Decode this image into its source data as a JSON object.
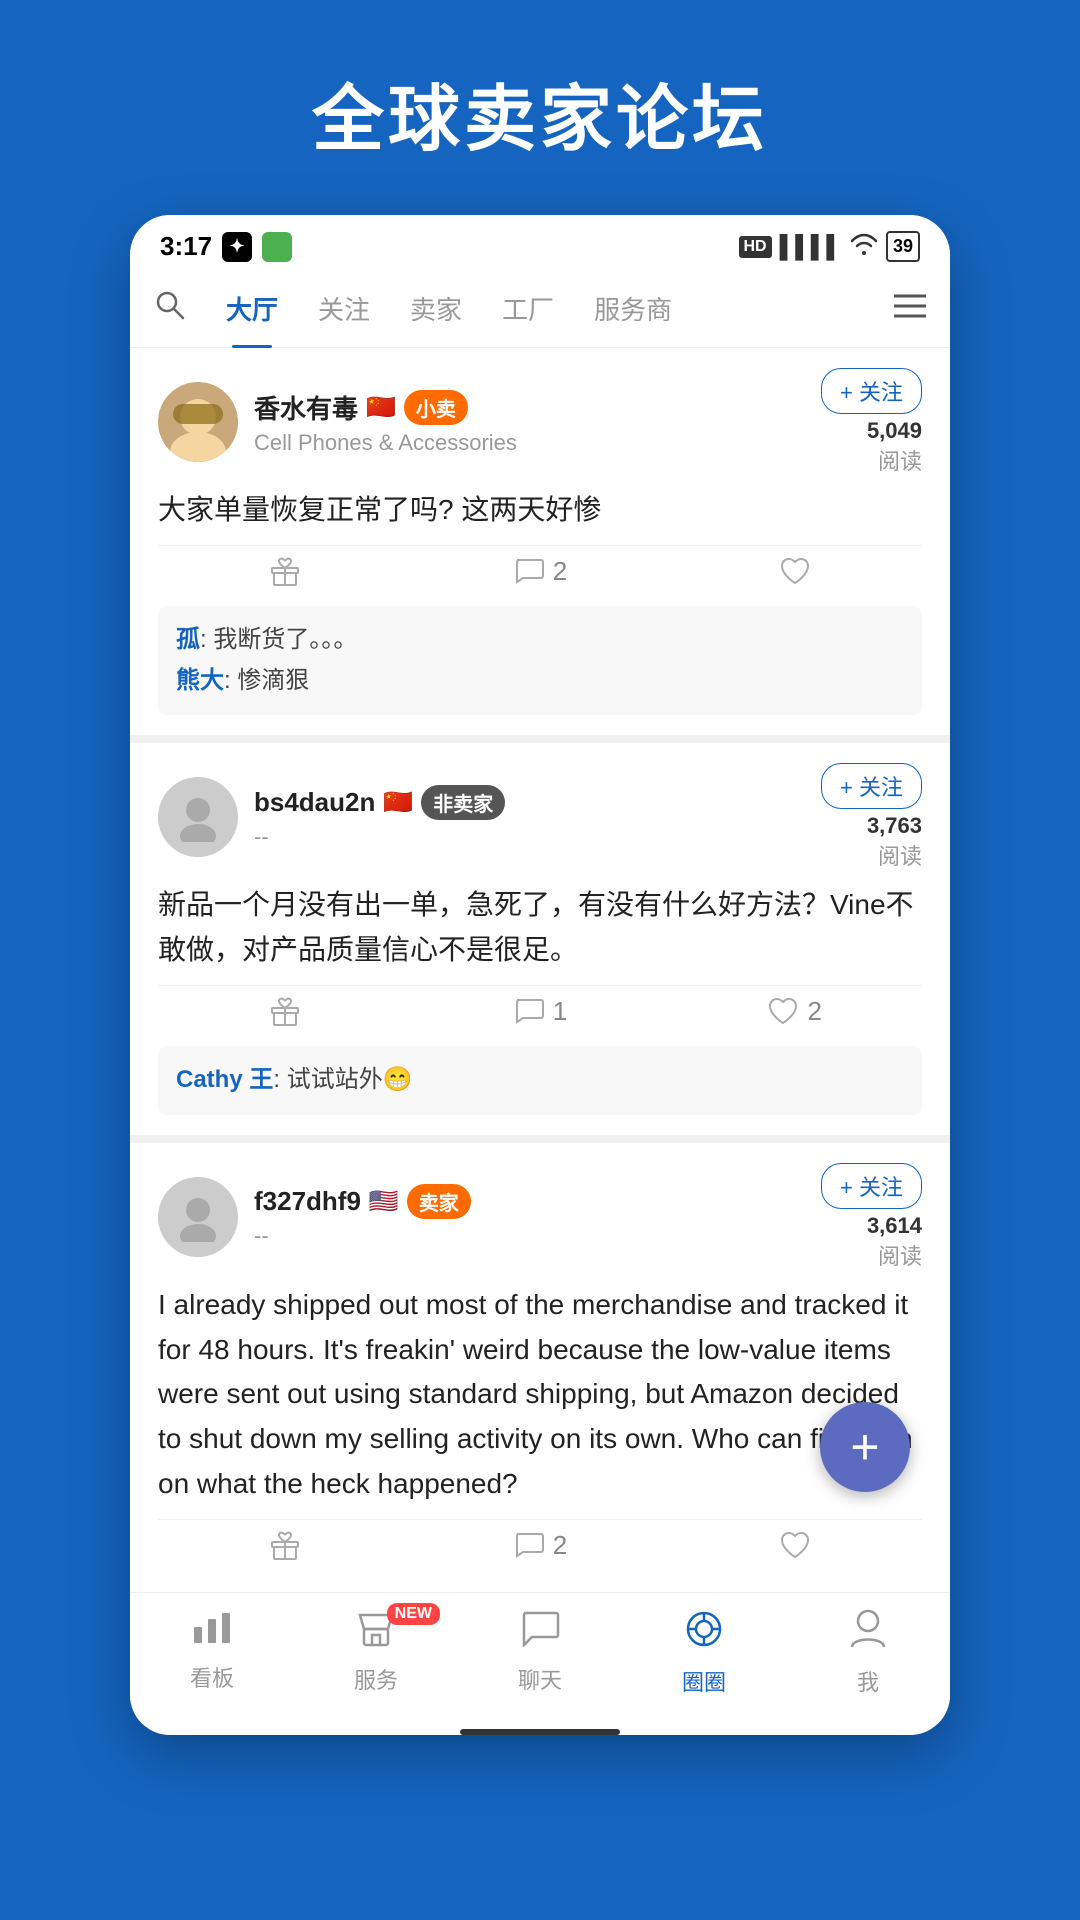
{
  "page": {
    "title": "全球卖家论坛",
    "background_color": "#1565C0"
  },
  "status_bar": {
    "time": "3:17",
    "battery": "39",
    "hd_label": "HD"
  },
  "nav": {
    "tabs": [
      {
        "id": "datang",
        "label": "大厅",
        "active": true
      },
      {
        "id": "follow",
        "label": "关注",
        "active": false
      },
      {
        "id": "seller",
        "label": "卖家",
        "active": false
      },
      {
        "id": "factory",
        "label": "工厂",
        "active": false
      },
      {
        "id": "service",
        "label": "服务商",
        "active": false
      }
    ]
  },
  "posts": [
    {
      "id": "post1",
      "user": {
        "name": "香水有毒",
        "flag": "🇨🇳",
        "badge": "小卖",
        "badge_type": "seller",
        "subtitle": "Cell Phones & Accessories",
        "has_avatar": true
      },
      "follow_label": "+ 关注",
      "read_count": "5,049",
      "read_label": "阅读",
      "content": "大家单量恢复正常了吗? 这两天好惨",
      "actions": {
        "gift": "",
        "comment": "2",
        "like": ""
      },
      "comments": [
        {
          "user": "孤",
          "text": "我断货了。。。"
        },
        {
          "user": "熊大",
          "text": "惨滴狠"
        }
      ]
    },
    {
      "id": "post2",
      "user": {
        "name": "bs4dau2n",
        "flag": "🇨🇳",
        "badge": "非卖家",
        "badge_type": "non-seller",
        "subtitle": "--",
        "has_avatar": false
      },
      "follow_label": "+ 关注",
      "read_count": "3,763",
      "read_label": "阅读",
      "content": "新品一个月没有出一单，急死了，有没有什么好方法？Vine不敢做，对产品质量信心不是很足。",
      "actions": {
        "gift": "",
        "comment": "1",
        "like": "2"
      },
      "comments": [
        {
          "user": "Cathy 王",
          "text": "试试站外😁"
        }
      ]
    },
    {
      "id": "post3",
      "user": {
        "name": "f327dhf9",
        "flag": "🇺🇸",
        "badge": "卖家",
        "badge_type": "seller",
        "subtitle": "--",
        "has_avatar": false
      },
      "follow_label": "+ 关注",
      "read_count": "3,614",
      "read_label": "阅读",
      "content": "I already shipped out most of the merchandise and tracked it for 48 hours. It's freakin' weird because the low-value items were sent out using standard shipping, but Amazon decided to shut down my selling activity on its own. Who can fill me in on what the heck happened?",
      "actions": {
        "gift": "",
        "comment": "2",
        "like": ""
      },
      "comments": []
    }
  ],
  "fab": {
    "label": "+"
  },
  "bottom_nav": {
    "items": [
      {
        "id": "dashboard",
        "label": "看板",
        "icon": "bar-chart",
        "active": false
      },
      {
        "id": "service",
        "label": "服务",
        "icon": "shop",
        "active": false,
        "badge": "NEW"
      },
      {
        "id": "chat",
        "label": "聊天",
        "icon": "chat",
        "active": false
      },
      {
        "id": "circle",
        "label": "圈圈",
        "icon": "circle",
        "active": true
      },
      {
        "id": "me",
        "label": "我",
        "icon": "person",
        "active": false
      }
    ]
  }
}
